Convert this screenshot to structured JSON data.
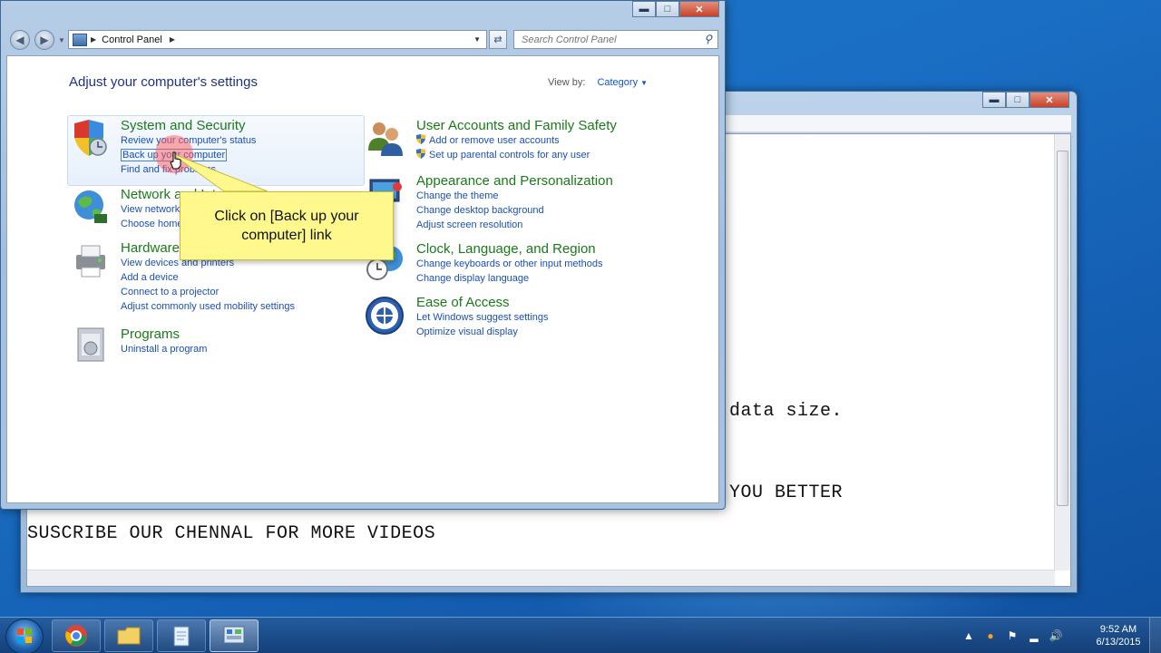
{
  "notepad": {
    "lines": [
      {
        "text": "data size."
      },
      {
        "text": "YOU BETTER"
      },
      {
        "text": "SUSCRIBE OUR CHENNAL FOR MORE VIDEOS"
      }
    ]
  },
  "control_panel": {
    "breadcrumb": "Control Panel",
    "search_placeholder": "Search Control Panel",
    "heading": "Adjust your computer's settings",
    "view_by_label": "View by:",
    "view_by_value": "Category",
    "categories": [
      {
        "title": "System and Security",
        "links": [
          "Review your computer's status",
          "Back up your computer",
          "Find and fix problems"
        ],
        "icon": "shield-icon"
      },
      {
        "title": "Network and Internet",
        "links": [
          "View network status and tasks",
          "Choose homegroup and sharing options"
        ],
        "icon": "globe-network-icon"
      },
      {
        "title": "Hardware and Sound",
        "links": [
          "View devices and printers",
          "Add a device",
          "Connect to a projector",
          "Adjust commonly used mobility settings"
        ],
        "icon": "printer-icon"
      },
      {
        "title": "Programs",
        "links": [
          "Uninstall a program"
        ],
        "icon": "programs-icon"
      },
      {
        "title": "User Accounts and Family Safety",
        "links": [
          "Add or remove user accounts",
          "Set up parental controls for any user"
        ],
        "icon": "users-icon"
      },
      {
        "title": "Appearance and Personalization",
        "links": [
          "Change the theme",
          "Change desktop background",
          "Adjust screen resolution"
        ],
        "icon": "display-icon"
      },
      {
        "title": "Clock, Language, and Region",
        "links": [
          "Change keyboards or other input methods",
          "Change display language"
        ],
        "icon": "clock-globe-icon"
      },
      {
        "title": "Ease of Access",
        "links": [
          "Let Windows suggest settings",
          "Optimize visual display"
        ],
        "icon": "ease-of-access-icon"
      }
    ],
    "tooltip": "Click on [Back up your computer] link"
  },
  "taskbar": {
    "time": "9:52 AM",
    "date": "6/13/2015",
    "apps": [
      {
        "name": "chrome-icon"
      },
      {
        "name": "folder-icon"
      },
      {
        "name": "notepad-icon"
      },
      {
        "name": "control-panel-icon"
      }
    ]
  },
  "colors": {
    "category_title": "#1a7a1a",
    "link": "#1a4fb5",
    "heading": "#1e3287",
    "tooltip_bg": "#fff98d"
  }
}
